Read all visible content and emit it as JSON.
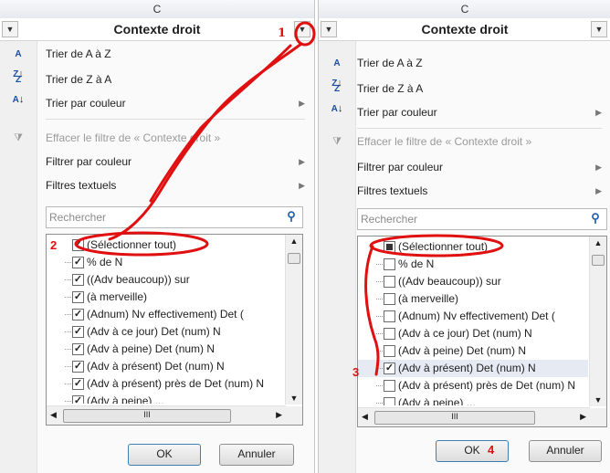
{
  "left": {
    "column_letter": "C",
    "header_title": "Contexte droit",
    "menu": {
      "sort_az": "Trier de A à Z",
      "sort_za": "Trier de Z à A",
      "sort_color": "Trier par couleur",
      "clear_filter": "Effacer le filtre de « Contexte droit »",
      "filter_color": "Filtrer par couleur",
      "text_filters": "Filtres textuels"
    },
    "search_placeholder": "Rechercher",
    "items": [
      "(Sélectionner tout)",
      "% de N",
      "((Adv beaucoup)) sur",
      "(à merveille)",
      "(Adnum) Nv effectivement) Det (",
      "(Adv à ce jour) Det (num) N",
      "(Adv à peine) Det (num) N",
      "(Adv à présent) Det (num) N",
      "(Adv à présent) près de Det (num) N",
      "(Adv à peine) ..."
    ],
    "ok_label": "OK",
    "cancel_label": "Annuler"
  },
  "right": {
    "column_letter": "C",
    "header_title": "Contexte droit",
    "menu": {
      "sort_az": "Trier de A à Z",
      "sort_za": "Trier de Z à A",
      "sort_color": "Trier par couleur",
      "clear_filter": "Effacer le filtre de « Contexte droit »",
      "filter_color": "Filtrer par couleur",
      "text_filters": "Filtres textuels"
    },
    "search_placeholder": "Rechercher",
    "items": [
      "(Sélectionner tout)",
      "% de N",
      "((Adv beaucoup)) sur",
      "(à merveille)",
      "(Adnum) Nv effectivement) Det (",
      "(Adv à ce jour) Det (num) N",
      "(Adv à peine) Det (num) N",
      "(Adv à présent) Det (num) N",
      "(Adv à présent) près de Det (num) N",
      "(Adv à peine) ..."
    ],
    "ok_label": "OK",
    "cancel_label": "Annuler"
  },
  "hscroll_grip": "III",
  "annotations": {
    "step1": "1",
    "step2": "2",
    "step3": "3",
    "step4": "4"
  },
  "colors": {
    "annotation": "#e01010",
    "link_icon": "#1f5fa8"
  }
}
